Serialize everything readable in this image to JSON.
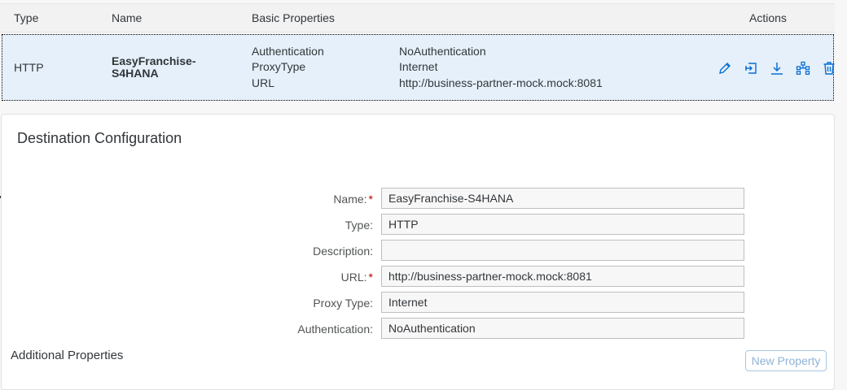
{
  "table": {
    "columns": {
      "type": "Type",
      "name": "Name",
      "basic": "Basic Properties",
      "actions": "Actions"
    },
    "row": {
      "type": "HTTP",
      "name_line1": "EasyFranchise-",
      "name_line2": "S4HANA",
      "properties": [
        {
          "key": "Authentication",
          "value": "NoAuthentication"
        },
        {
          "key": "ProxyType",
          "value": "Internet"
        },
        {
          "key": "URL",
          "value": "http://business-partner-mock.mock:8081"
        }
      ],
      "actions": [
        "edit-icon",
        "clone-icon",
        "export-icon",
        "check-connection-icon",
        "delete-icon"
      ]
    }
  },
  "config": {
    "title": "Destination Configuration",
    "fields": [
      {
        "label": "Name:",
        "required": "*",
        "value": "EasyFranchise-S4HANA"
      },
      {
        "label": "Type:",
        "required": "",
        "value": "HTTP"
      },
      {
        "label": "Description:",
        "required": "",
        "value": ""
      },
      {
        "label": "URL:",
        "required": "*",
        "value": "http://business-partner-mock.mock:8081"
      },
      {
        "label": "Proxy Type:",
        "required": "",
        "value": "Internet"
      },
      {
        "label": "Authentication:",
        "required": "",
        "value": "NoAuthentication"
      }
    ],
    "additional_title": "Additional Properties",
    "new_property_label": "New Property"
  },
  "colors": {
    "accent": "#0a6ed1",
    "required": "#bb0000",
    "row_selected": "#e5f0fa"
  }
}
